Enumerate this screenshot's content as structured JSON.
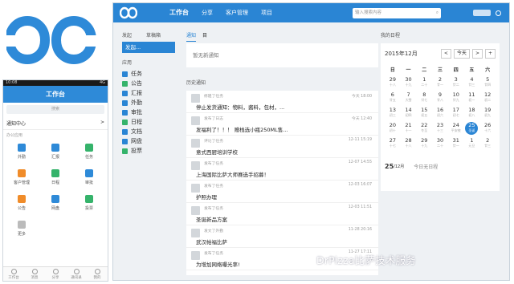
{
  "phone": {
    "status_time": "10:08",
    "status_right": "4G",
    "header_title": "工作台",
    "search_placeholder": "搜索",
    "section_title": "通知中心",
    "section_arrow": ">",
    "subsection": "办公应用",
    "apps": [
      {
        "label": "外勤",
        "color": "#2e8ad8"
      },
      {
        "label": "汇报",
        "color": "#2e8ad8"
      },
      {
        "label": "任务",
        "color": "#35b36b"
      },
      {
        "label": "客户管理",
        "color": "#f08c2a"
      },
      {
        "label": "日程",
        "color": "#35b36b"
      },
      {
        "label": "审批",
        "color": "#2e8ad8"
      },
      {
        "label": "公告",
        "color": "#f08c2a"
      },
      {
        "label": "网盘",
        "color": "#2e8ad8"
      },
      {
        "label": "投票",
        "color": "#35b36b"
      },
      {
        "label": "更多",
        "color": "#bbbbbb"
      }
    ],
    "tabs": [
      "工作台",
      "消息",
      "分享",
      "通讯录",
      "我的"
    ]
  },
  "topbar": {
    "nav": [
      "工作台",
      "分享",
      "客户管理",
      "项目"
    ],
    "search_placeholder": "输入搜索内容",
    "search_icon": "search-icon"
  },
  "sidebar": {
    "label_publish": "发起",
    "label_draft": "草稿箱",
    "publish_button": "发起...",
    "label_apps": "应用",
    "items": [
      {
        "label": "任务",
        "color": "#2a85d4"
      },
      {
        "label": "公告",
        "color": "#35b36b"
      },
      {
        "label": "汇报",
        "color": "#2a85d4"
      },
      {
        "label": "外勤",
        "color": "#2a85d4"
      },
      {
        "label": "审批",
        "color": "#2a85d4"
      },
      {
        "label": "日程",
        "color": "#35b36b"
      },
      {
        "label": "文档",
        "color": "#2a85d4"
      },
      {
        "label": "网盘",
        "color": "#2a85d4"
      },
      {
        "label": "投票",
        "color": "#35b36b"
      }
    ]
  },
  "notices": {
    "tab_notice": "通知",
    "tab_other": "目",
    "empty": "暂无新通知",
    "history_title": "历史通知",
    "history": [
      {
        "action": "修建了任务",
        "msg": "停止发货通知：物料，酱料，包材，...",
        "time": "今天 18:00"
      },
      {
        "action": "发布了日志",
        "msg": "发福利了！！！ 赠栈选小瓶250ML售...",
        "time": "今天 12:40"
      },
      {
        "action": "评论了任务",
        "msg": "意式西厨培训学校",
        "time": "12-11 15:19"
      },
      {
        "action": "发布了任务",
        "msg": "上海国际比萨大师赛选手招募！",
        "time": "12-07 14:55"
      },
      {
        "action": "发布了任务",
        "msg": "护照办理",
        "time": "12-03 16:07"
      },
      {
        "action": "发布了任务",
        "msg": "圣诞新品方案",
        "time": "12-03 11:51"
      },
      {
        "action": "发文了外勤",
        "msg": "武汉帕福比萨",
        "time": "11-28 20:16"
      },
      {
        "action": "发布了任务",
        "msg": "为增加网络曝光率!",
        "time": "11-27 17:11"
      }
    ]
  },
  "calendar": {
    "section_title": "我的日程",
    "month": "2015年12月",
    "prev": "<",
    "today_btn": "今天",
    "next": ">",
    "add": "+",
    "weekdays": [
      "日",
      "一",
      "二",
      "三",
      "四",
      "五",
      "六"
    ],
    "days": [
      {
        "d": "29",
        "l": "十八"
      },
      {
        "d": "30",
        "l": "十九"
      },
      {
        "d": "1",
        "l": "二十"
      },
      {
        "d": "2",
        "l": "廿一"
      },
      {
        "d": "3",
        "l": "廿二"
      },
      {
        "d": "4",
        "l": "廿三"
      },
      {
        "d": "5",
        "l": "廿四"
      },
      {
        "d": "6",
        "l": "廿五"
      },
      {
        "d": "7",
        "l": "大雪"
      },
      {
        "d": "8",
        "l": "廿七"
      },
      {
        "d": "9",
        "l": "廿八"
      },
      {
        "d": "10",
        "l": "廿九"
      },
      {
        "d": "11",
        "l": "初一"
      },
      {
        "d": "12",
        "l": "初二"
      },
      {
        "d": "13",
        "l": "初三"
      },
      {
        "d": "14",
        "l": "初四"
      },
      {
        "d": "15",
        "l": "初五"
      },
      {
        "d": "16",
        "l": "初六"
      },
      {
        "d": "17",
        "l": "初七"
      },
      {
        "d": "18",
        "l": "初八"
      },
      {
        "d": "19",
        "l": "初九"
      },
      {
        "d": "20",
        "l": "初十"
      },
      {
        "d": "21",
        "l": "十一"
      },
      {
        "d": "22",
        "l": "冬至"
      },
      {
        "d": "23",
        "l": "十三"
      },
      {
        "d": "24",
        "l": "平安夜"
      },
      {
        "d": "25",
        "l": "圣诞"
      },
      {
        "d": "26",
        "l": "十六"
      },
      {
        "d": "27",
        "l": "十七"
      },
      {
        "d": "28",
        "l": "十八"
      },
      {
        "d": "29",
        "l": "十九"
      },
      {
        "d": "30",
        "l": "二十"
      },
      {
        "d": "31",
        "l": "廿一"
      },
      {
        "d": "1",
        "l": "元旦"
      },
      {
        "d": "2",
        "l": "廿三"
      }
    ],
    "selected_day": "25",
    "footer_day": "25",
    "footer_month": "/12月",
    "footer_text": "今日无日程"
  },
  "watermark": "DrPizza比萨技术服务"
}
